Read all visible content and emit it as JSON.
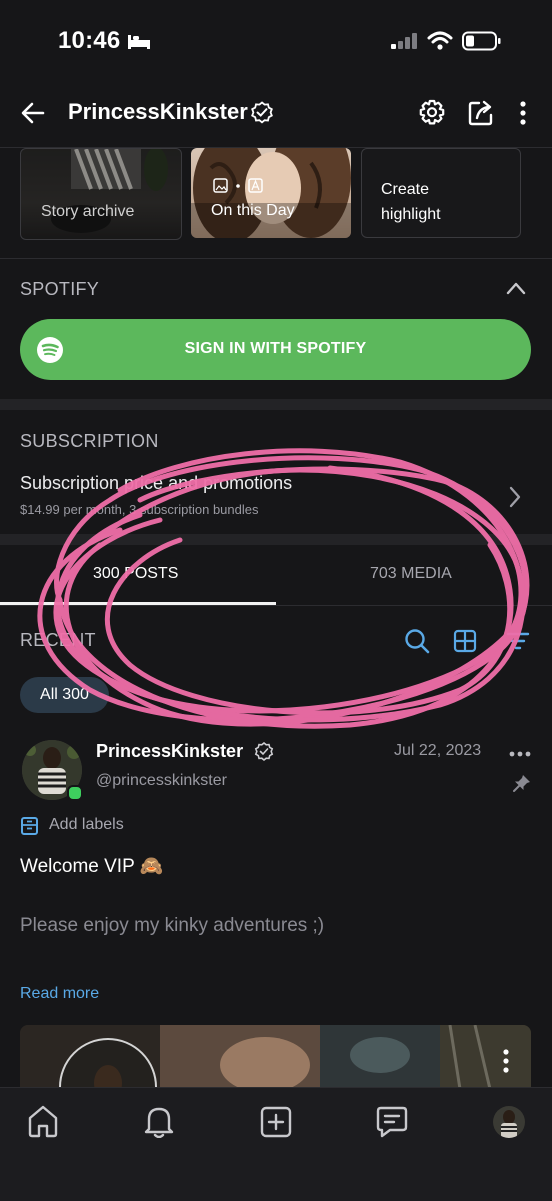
{
  "status_bar": {
    "time": "10:46"
  },
  "header": {
    "title": "PrincessKinkster"
  },
  "highlights": [
    {
      "label": "Story archive"
    },
    {
      "label": "On this Day"
    },
    {
      "label_line1": "Create",
      "label_line2": "highlight"
    }
  ],
  "spotify": {
    "section_title": "SPOTIFY",
    "button_label": "SIGN IN WITH SPOTIFY"
  },
  "subscription": {
    "section_title": "SUBSCRIPTION",
    "row_title": "Subscription price and promotions",
    "row_subtitle": "$14.99 per month, 3 subscription bundles"
  },
  "tabs": [
    {
      "label": "300 POSTS",
      "active": true
    },
    {
      "label": "703 MEDIA",
      "active": false
    }
  ],
  "feed": {
    "section_title": "RECENT",
    "filter_label": "All 300"
  },
  "post": {
    "author_name": "PrincessKinkster",
    "handle": "@princesskinkster",
    "date": "Jul 22, 2023",
    "labels_action": "Add labels",
    "text_line1": "Welcome VIP 🙈",
    "text_line2": "Please enjoy my kinky adventures ;)",
    "read_more": "Read more"
  },
  "colors": {
    "background": "#161618",
    "accent_blue": "#5aa9e6",
    "spotify_green": "#5cb85c",
    "annotation_pink": "#f06ea8",
    "online_dot": "#3ecf5e"
  },
  "icons": {
    "header": [
      "back-arrow-icon",
      "verified-badge-icon",
      "settings-gear-icon",
      "share-icon",
      "more-vertical-icon"
    ],
    "nav": [
      "home-icon",
      "bell-icon",
      "add-post-icon",
      "messages-icon",
      "profile-avatar"
    ]
  }
}
